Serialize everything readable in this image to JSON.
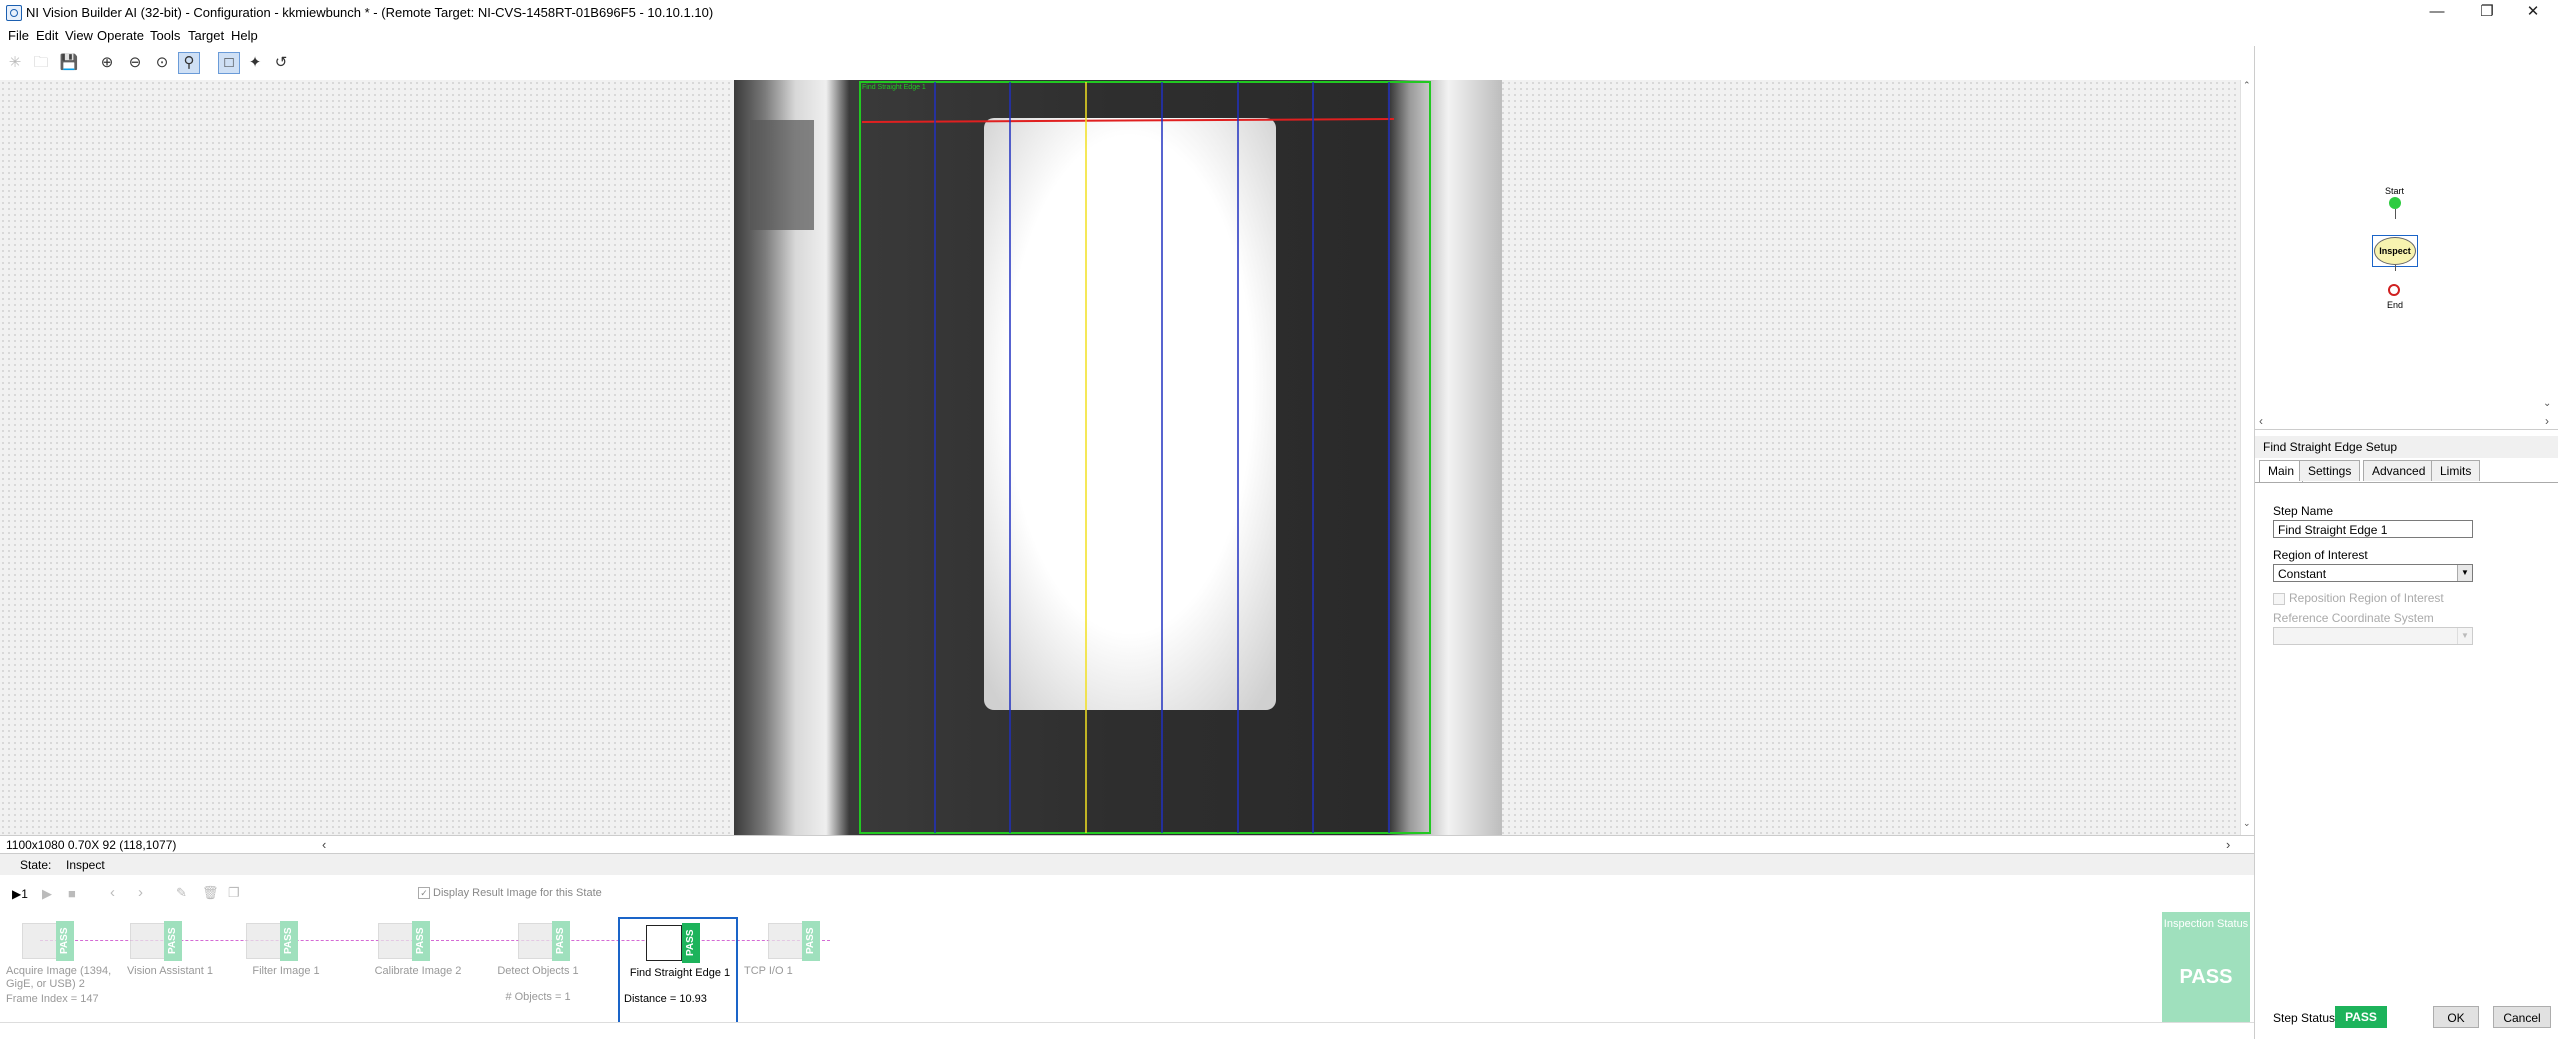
{
  "window": {
    "title": "NI Vision Builder AI (32-bit) - Configuration - kkmiewbunch * - (Remote Target: NI-CVS-1458RT-01B696F5 - 10.10.1.10)",
    "controls": [
      "minimize-icon",
      "restore-icon",
      "close-icon"
    ]
  },
  "menu": [
    "File",
    "Edit",
    "View",
    "Operate",
    "Tools",
    "Target",
    "Help"
  ],
  "toolbar": {
    "icons": [
      "star-icon",
      "open-folder-icon",
      "save-icon",
      "zoom-in-icon",
      "zoom-out-icon",
      "zoom-fit-icon",
      "zoom-100-icon",
      "rectangle-roi-icon",
      "point-tool-icon",
      "rotate-tool-icon"
    ],
    "help": "?"
  },
  "viewer": {
    "overlay_label": "Find Straight Edge 1",
    "status": "1100x1080 0.70X 92   (118,1077)"
  },
  "state": {
    "label": "State:",
    "value": "Inspect"
  },
  "steps_toolbar": {
    "run_label": "▶1",
    "display_checkbox_label": "Display Result Image for this State",
    "display_checked": true
  },
  "steps": [
    {
      "name": "Acquire Image (1394, GigE, or USB) 2",
      "extra": "Frame Index = 147",
      "status": "PASS",
      "icon": "camera-icon",
      "active": false
    },
    {
      "name": "Vision Assistant 1",
      "extra": "",
      "status": "PASS",
      "icon": "vision-assistant-icon",
      "active": false
    },
    {
      "name": "Filter Image 1",
      "extra": "",
      "status": "PASS",
      "icon": "filter-icon",
      "active": false
    },
    {
      "name": "Calibrate Image 2",
      "extra": "",
      "status": "PASS",
      "icon": "calibrate-icon",
      "active": false
    },
    {
      "name": "Detect Objects 1",
      "extra": "# Objects = 1",
      "status": "PASS",
      "icon": "detect-objects-icon",
      "active": false
    },
    {
      "name": "Find Straight Edge 1",
      "extra": "Distance = 10.93",
      "status": "PASS",
      "icon": "straight-edge-icon",
      "active": true
    },
    {
      "name": "TCP I/O 1",
      "extra": "",
      "status": "PASS",
      "icon": "tcp-io-icon",
      "active": false
    }
  ],
  "inspection_status": {
    "title": "Inspection Status",
    "value": "PASS"
  },
  "flow": {
    "start": "Start",
    "state": "Inspect",
    "end": "End"
  },
  "setup": {
    "title": "Find Straight Edge Setup",
    "tabs": [
      "Main",
      "Settings",
      "Advanced",
      "Limits"
    ],
    "active_tab": "Main",
    "step_name_label": "Step Name",
    "step_name_value": "Find Straight Edge 1",
    "roi_label": "Region of Interest",
    "roi_value": "Constant",
    "reposition_label": "Reposition Region of Interest",
    "reference_label": "Reference Coordinate System",
    "step_status_label": "Step Status",
    "step_status_value": "PASS",
    "ok": "OK",
    "cancel": "Cancel"
  },
  "colors": {
    "pass_green": "#1db35b",
    "pass_light": "#9fe0bd",
    "roi_green": "#22c822",
    "edge_red": "#e02020",
    "search_blue": "#2030c0",
    "edge_yellow": "#f2e020",
    "selection_blue": "#1a64c8"
  }
}
